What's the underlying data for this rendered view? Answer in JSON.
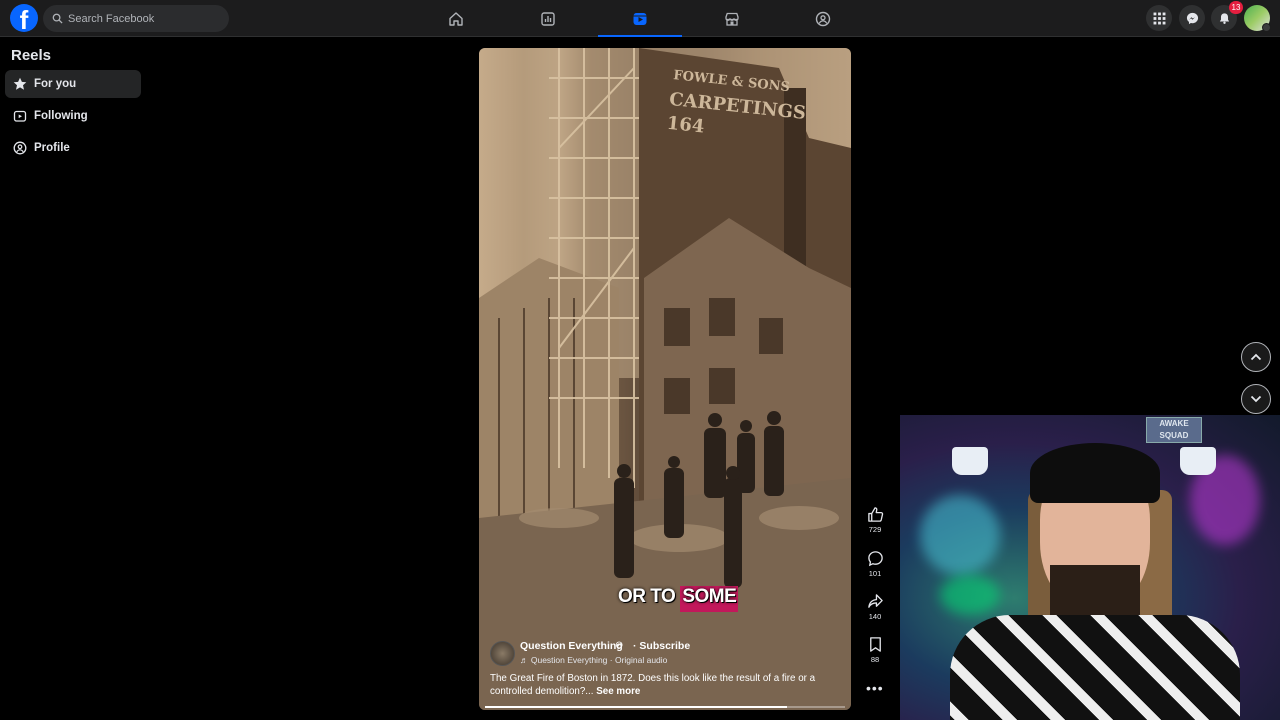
{
  "header": {
    "logo": "f",
    "search_placeholder": "Search Facebook",
    "nav": [
      "home-icon",
      "stats-icon",
      "reels-icon",
      "marketplace-icon",
      "groups-icon"
    ],
    "active_nav": "reels-icon",
    "notifications_count": "13"
  },
  "sidebar": {
    "title": "Reels",
    "items": [
      {
        "label": "For you",
        "icon": "star-icon"
      },
      {
        "label": "Following",
        "icon": "following-icon"
      },
      {
        "label": "Profile",
        "icon": "profile-icon"
      }
    ]
  },
  "video": {
    "photo_text": [
      "FOWLE & SONS",
      "CARPETINGS",
      "164"
    ],
    "caption_words": [
      "OR TO",
      "SOME"
    ],
    "author": "Question Everything",
    "verified_glyph": "⊘",
    "subscribe": "· Subscribe",
    "audio": "♬ Question Everything · Original audio",
    "description": "The Great Fire of Boston in 1872. Does this look like the result of a fire or a controlled demolition?...",
    "see_more": "See more",
    "progress": 0.84
  },
  "actions": {
    "likes": "729",
    "comments": "101",
    "shares": "140",
    "saves": "88",
    "more": "•••"
  },
  "webcam": {
    "sign_text": [
      "AWAKE",
      "SQUAD"
    ]
  },
  "colors": {
    "accent": "#0866ff",
    "badge": "#e41e3f",
    "caption_highlight": "#c2185b"
  }
}
